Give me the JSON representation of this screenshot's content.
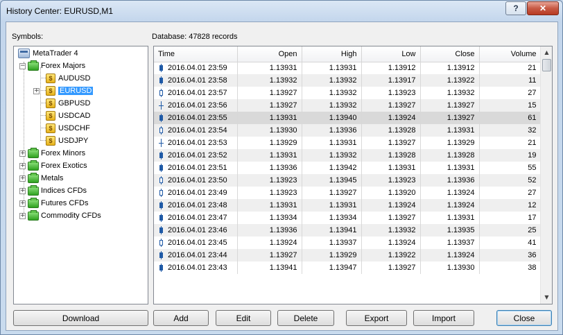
{
  "window": {
    "title": "History Center: EURUSD,M1",
    "help_glyph": "?",
    "close_glyph": "✕"
  },
  "symbols_label": "Symbols:",
  "database_label": "Database: 47828 records",
  "tree": {
    "root": "MetaTrader 4",
    "groups": [
      "Forex Majors",
      "Forex Minors",
      "Forex Exotics",
      "Metals",
      "Indices CFDs",
      "Futures CFDs",
      "Commodity CFDs"
    ],
    "majors": [
      "AUDUSD",
      "EURUSD",
      "GBPUSD",
      "USDCAD",
      "USDCHF",
      "USDJPY"
    ],
    "selected": "EURUSD"
  },
  "table": {
    "columns": [
      "Time",
      "Open",
      "High",
      "Low",
      "Close",
      "Volume"
    ],
    "rows": [
      [
        "2016.04.01 23:59",
        "1.13931",
        "1.13931",
        "1.13912",
        "1.13912",
        "21"
      ],
      [
        "2016.04.01 23:58",
        "1.13932",
        "1.13932",
        "1.13917",
        "1.13922",
        "11"
      ],
      [
        "2016.04.01 23:57",
        "1.13927",
        "1.13932",
        "1.13923",
        "1.13932",
        "27"
      ],
      [
        "2016.04.01 23:56",
        "1.13927",
        "1.13932",
        "1.13927",
        "1.13927",
        "15"
      ],
      [
        "2016.04.01 23:55",
        "1.13931",
        "1.13940",
        "1.13924",
        "1.13927",
        "61"
      ],
      [
        "2016.04.01 23:54",
        "1.13930",
        "1.13936",
        "1.13928",
        "1.13931",
        "32"
      ],
      [
        "2016.04.01 23:53",
        "1.13929",
        "1.13931",
        "1.13927",
        "1.13929",
        "21"
      ],
      [
        "2016.04.01 23:52",
        "1.13931",
        "1.13932",
        "1.13928",
        "1.13928",
        "19"
      ],
      [
        "2016.04.01 23:51",
        "1.13936",
        "1.13942",
        "1.13931",
        "1.13931",
        "55"
      ],
      [
        "2016.04.01 23:50",
        "1.13923",
        "1.13945",
        "1.13923",
        "1.13936",
        "52"
      ],
      [
        "2016.04.01 23:49",
        "1.13923",
        "1.13927",
        "1.13920",
        "1.13924",
        "27"
      ],
      [
        "2016.04.01 23:48",
        "1.13931",
        "1.13931",
        "1.13924",
        "1.13924",
        "12"
      ],
      [
        "2016.04.01 23:47",
        "1.13934",
        "1.13934",
        "1.13927",
        "1.13931",
        "17"
      ],
      [
        "2016.04.01 23:46",
        "1.13936",
        "1.13941",
        "1.13932",
        "1.13935",
        "25"
      ],
      [
        "2016.04.01 23:45",
        "1.13924",
        "1.13937",
        "1.13924",
        "1.13937",
        "41"
      ],
      [
        "2016.04.01 23:44",
        "1.13927",
        "1.13929",
        "1.13922",
        "1.13924",
        "36"
      ],
      [
        "2016.04.01 23:43",
        "1.13941",
        "1.13947",
        "1.13927",
        "1.13930",
        "38"
      ]
    ],
    "candle_types": [
      "bear",
      "bear",
      "bull",
      "doji",
      "bear",
      "bull",
      "doji",
      "bear",
      "bear",
      "bull",
      "bull",
      "bear",
      "bear",
      "bear",
      "bull",
      "bear",
      "bear"
    ]
  },
  "buttons": {
    "download": "Download",
    "add": "Add",
    "edit": "Edit",
    "delete": "Delete",
    "export": "Export",
    "import": "Import",
    "close": "Close"
  }
}
